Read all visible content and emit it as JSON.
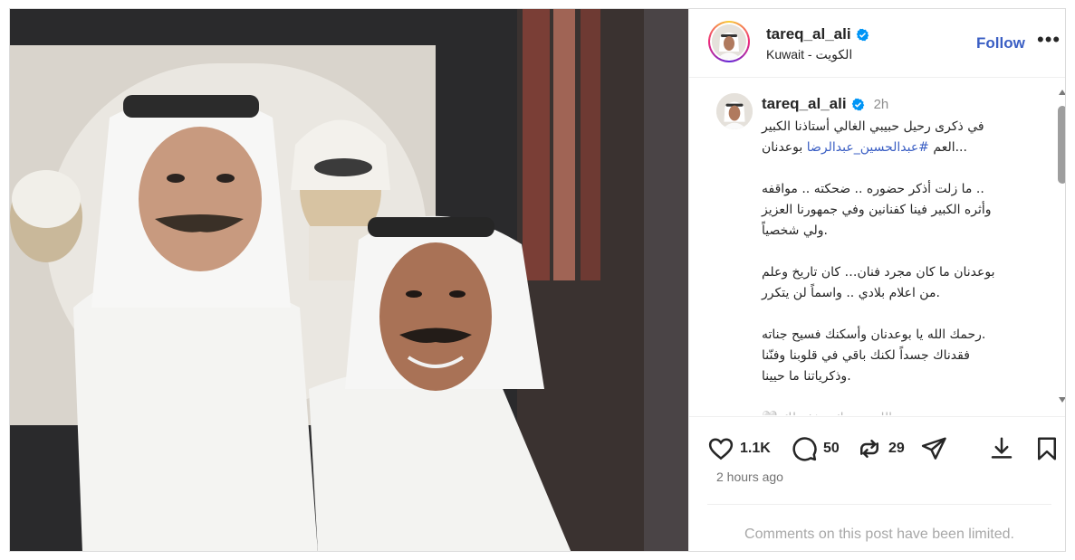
{
  "post": {
    "author": {
      "username": "tareq_al_ali",
      "verified": true,
      "location": "Kuwait - الكويت"
    },
    "follow_label": "Follow",
    "more_label": "•••",
    "caption": {
      "username": "tareq_al_ali",
      "time": "2h",
      "lines": [
        {
          "text": "في ذكرى رحيل حبيبي الغالي أستاذنا الكبير"
        },
        {
          "prefix": "العم ",
          "hashtag": "#عبدالحسين_عبدالرضا",
          "suffix": " بوعدنان..."
        },
        {
          "gap": true
        },
        {
          "text": "ما زلت أذكر حضوره .. ضحكته .. مواقفه .."
        },
        {
          "text": "وأثره الكبير فينا كفنانين وفي جمهورنا العزيز"
        },
        {
          "text": "ولي شخصياً."
        },
        {
          "gap": true
        },
        {
          "text": "بوعدنان ما كان مجرد فنان… كان تاريخ وعلم"
        },
        {
          "text": "من اعلام بلادي .. واسماً لن يتكرر."
        },
        {
          "gap": true
        },
        {
          "text": "رحمك الله يا بوعدنان وأسكنك فسيح جناته."
        },
        {
          "text": "فقدناك جسداً لكنك باقي في قلوبنا وفنّنا"
        },
        {
          "text": "وذكرياتنا ما حيينا."
        },
        {
          "gap": true
        },
        {
          "text": "🤍 الله يرحمك ويغفر لك",
          "faded": true
        }
      ]
    },
    "actions": {
      "likes": "1.1K",
      "comments": "50",
      "reposts": "29"
    },
    "time_ago": "2 hours ago",
    "comments_notice": "Comments on this post have been limited."
  },
  "icons": {
    "verified": "verified-badge-icon",
    "like": "heart-icon",
    "comment": "comment-bubble-icon",
    "repost": "repost-icon",
    "share": "send-icon",
    "save": "bookmark-icon",
    "more": "more-options-icon"
  },
  "colors": {
    "accent": "#3b5fc4",
    "verified": "#0095f6",
    "text": "#262626",
    "muted": "#737373"
  }
}
